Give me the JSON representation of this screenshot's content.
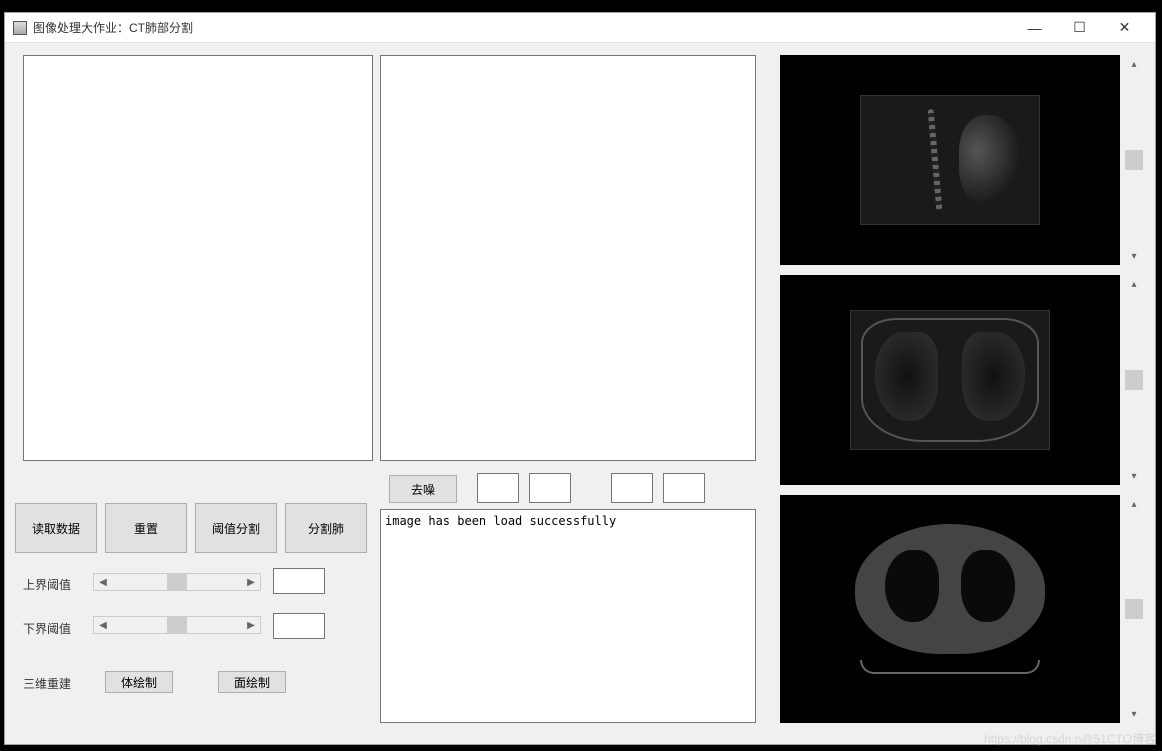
{
  "window": {
    "title": "图像处理大作业：CT肺部分割"
  },
  "buttons": {
    "denoise": "去噪",
    "load": "读取数据",
    "reset": "重置",
    "threshold": "阈值分割",
    "segment": "分割肺",
    "volume_render": "体绘制",
    "surface_render": "面绘制"
  },
  "labels": {
    "upper_threshold": "上界阈值",
    "lower_threshold": "下界阈值",
    "reconstruct_3d": "三维重建"
  },
  "log": {
    "line1": "image has been load successfully"
  },
  "inputs": {
    "upper_value": "",
    "lower_value": "",
    "box1": "",
    "box2": "",
    "box3": "",
    "box4": ""
  },
  "watermark": "https://blog.csdn.n@51CTO博客"
}
